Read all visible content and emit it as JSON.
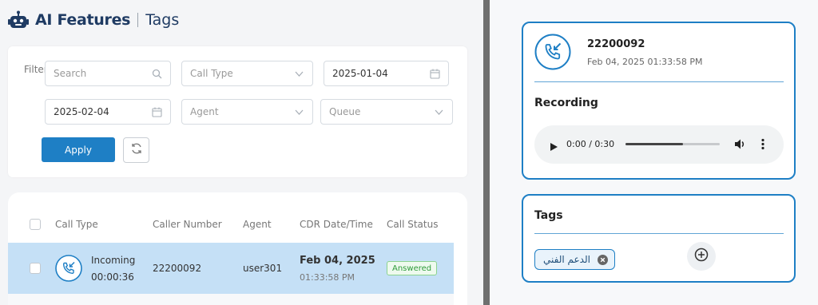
{
  "header": {
    "title": "AI Features",
    "subtitle": "Tags"
  },
  "filters": {
    "label": "Filter",
    "search_placeholder": "Search",
    "call_type_placeholder": "Call Type",
    "date_from": "2025-01-04",
    "date_to": "2025-02-04",
    "agent_placeholder": "Agent",
    "queue_placeholder": "Queue",
    "apply_label": "Apply"
  },
  "table": {
    "columns": [
      "Call Type",
      "Caller Number",
      "Agent",
      "CDR Date/Time",
      "Call Status"
    ],
    "rows": [
      {
        "call_type": "Incoming",
        "duration": "00:00:36",
        "caller_number": "22200092",
        "agent": "user301",
        "date": "Feb 04, 2025",
        "time": "01:33:58 PM",
        "status": "Answered"
      }
    ]
  },
  "detail": {
    "caller_number": "22200092",
    "datetime": "Feb 04, 2025 01:33:58 PM",
    "recording_title": "Recording",
    "player_time": "0:00 / 0:30",
    "player_progress": 0.61,
    "tags_title": "Tags",
    "tags": [
      "الدعم الفني"
    ]
  },
  "colors": {
    "accent": "#1e7fc5",
    "title": "#1f3b63",
    "row_selected": "#c5e0f6",
    "status_green": "#2e9b3a"
  },
  "icons": [
    "robot-icon",
    "search-icon",
    "chevron-down-icon",
    "calendar-icon",
    "refresh-icon",
    "incoming-call-icon",
    "play-icon",
    "volume-icon",
    "more-vert-icon",
    "close-circle-icon",
    "add-circle-icon"
  ]
}
